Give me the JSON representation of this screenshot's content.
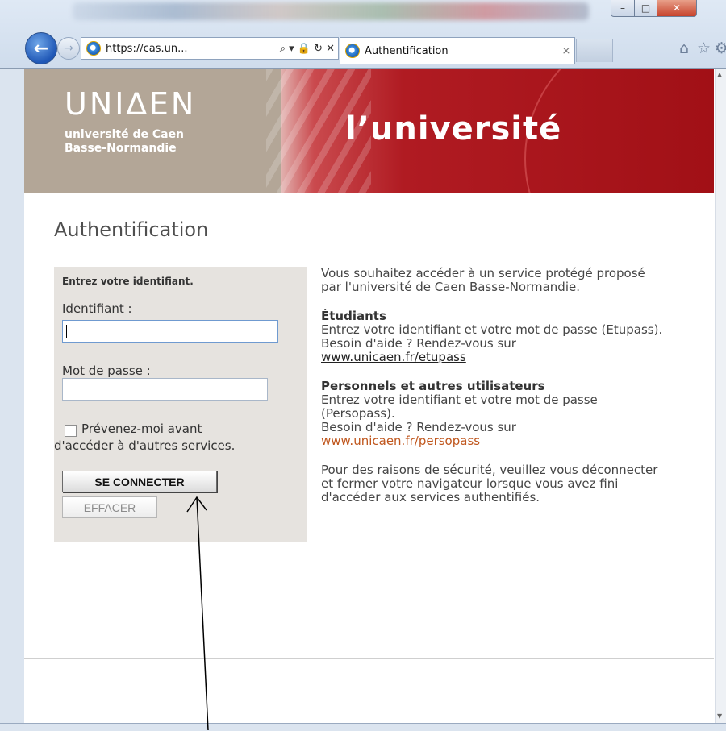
{
  "browser": {
    "address_url": "https://cas.un...",
    "address_controls": "⌕ ▾ 🔒 ↻ ✕",
    "tab_title": "Authentification",
    "tab_close": "×",
    "back_icon": "←",
    "forward_icon": "→",
    "min_icon": "–",
    "max_icon": "□",
    "close_icon": "✕",
    "home_icon": "⌂",
    "star_icon": "☆",
    "gear_icon": "⚙"
  },
  "banner": {
    "logo_mark": "UNI∆EN",
    "logo_line1": "université de Caen",
    "logo_line2": "Basse-Normandie",
    "title": "l’université"
  },
  "page": {
    "heading": "Authentification"
  },
  "login": {
    "hint": "Entrez votre identifiant.",
    "id_label": "Identifiant :",
    "id_value": "",
    "password_label": "Mot de passe :",
    "password_value": "",
    "remember_label_line1": "Prévenez-moi avant",
    "remember_label_line2": "d'accéder à d'autres services.",
    "remember_checked": false,
    "connect_button": "SE CONNECTER",
    "clear_button": "EFFACER"
  },
  "info": {
    "intro": "Vous souhaitez accéder à un service protégé proposé par l'université de Caen Basse-Normandie.",
    "students_heading": "Étudiants",
    "students_text": "Entrez votre identifiant et votre mot de passe (Etupass).",
    "students_help": "Besoin d'aide ? Rendez-vous sur",
    "students_link": "www.unicaen.fr/etupass",
    "staff_heading": "Personnels et autres utilisateurs",
    "staff_text": "Entrez votre identifiant et votre mot de passe (Persopass).",
    "staff_help": "Besoin d'aide ? Rendez-vous sur",
    "staff_link": "www.unicaen.fr/persopass",
    "security_note": "Pour des raisons de sécurité, veuillez vous déconnecter et fermer votre navigateur lorsque vous avez fini d'accéder aux services authentifiés."
  },
  "colors": {
    "banner_red": "#a11016",
    "banner_taupe": "#b3a697",
    "login_box_bg": "#e6e3df",
    "link_orange": "#c0571e"
  }
}
